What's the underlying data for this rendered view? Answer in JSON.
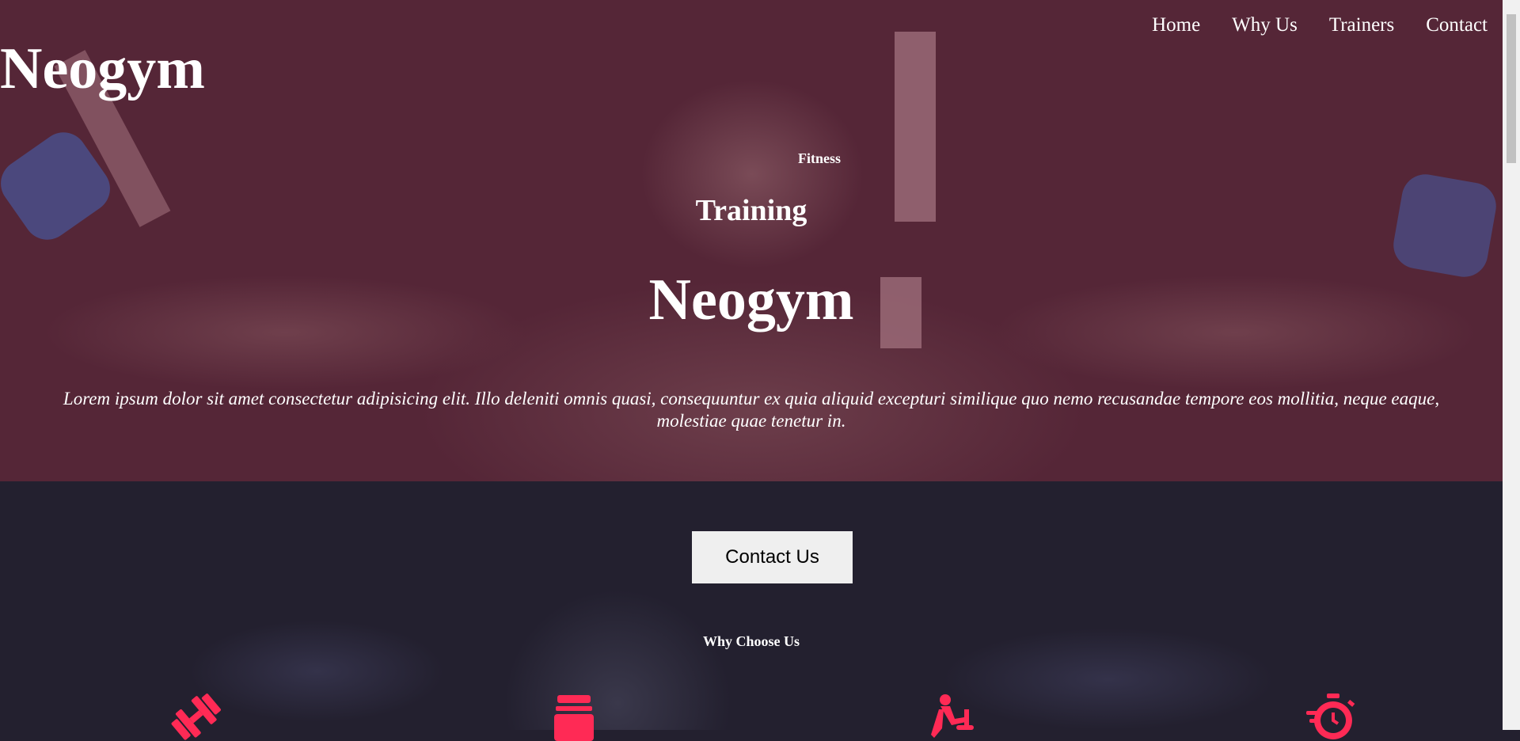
{
  "header": {
    "logo": "Neogym",
    "nav": [
      {
        "label": "Home"
      },
      {
        "label": "Why Us"
      },
      {
        "label": "Trainers"
      },
      {
        "label": "Contact"
      }
    ]
  },
  "hero": {
    "eyebrow": "Fitness",
    "subtitle": "Training",
    "title": "Neogym",
    "description": "Lorem ipsum dolor sit amet consectetur adipisicing elit. Illo deleniti omnis quasi, consequuntur ex quia aliquid excepturi similique quo nemo recusandae tempore eos mollitia, neque eaque, molestiae quae tenetur in."
  },
  "cta": {
    "label": "Contact Us"
  },
  "why": {
    "heading": "Why Choose Us",
    "features": [
      {
        "icon": "dumbbell-icon"
      },
      {
        "icon": "supplement-jar-icon"
      },
      {
        "icon": "cycling-trainer-icon"
      },
      {
        "icon": "stopwatch-icon"
      }
    ]
  },
  "colors": {
    "accent": "#ff2a55",
    "hero_overlay": "#552637",
    "lower_background": "#23202f",
    "button_background": "#efefef"
  }
}
